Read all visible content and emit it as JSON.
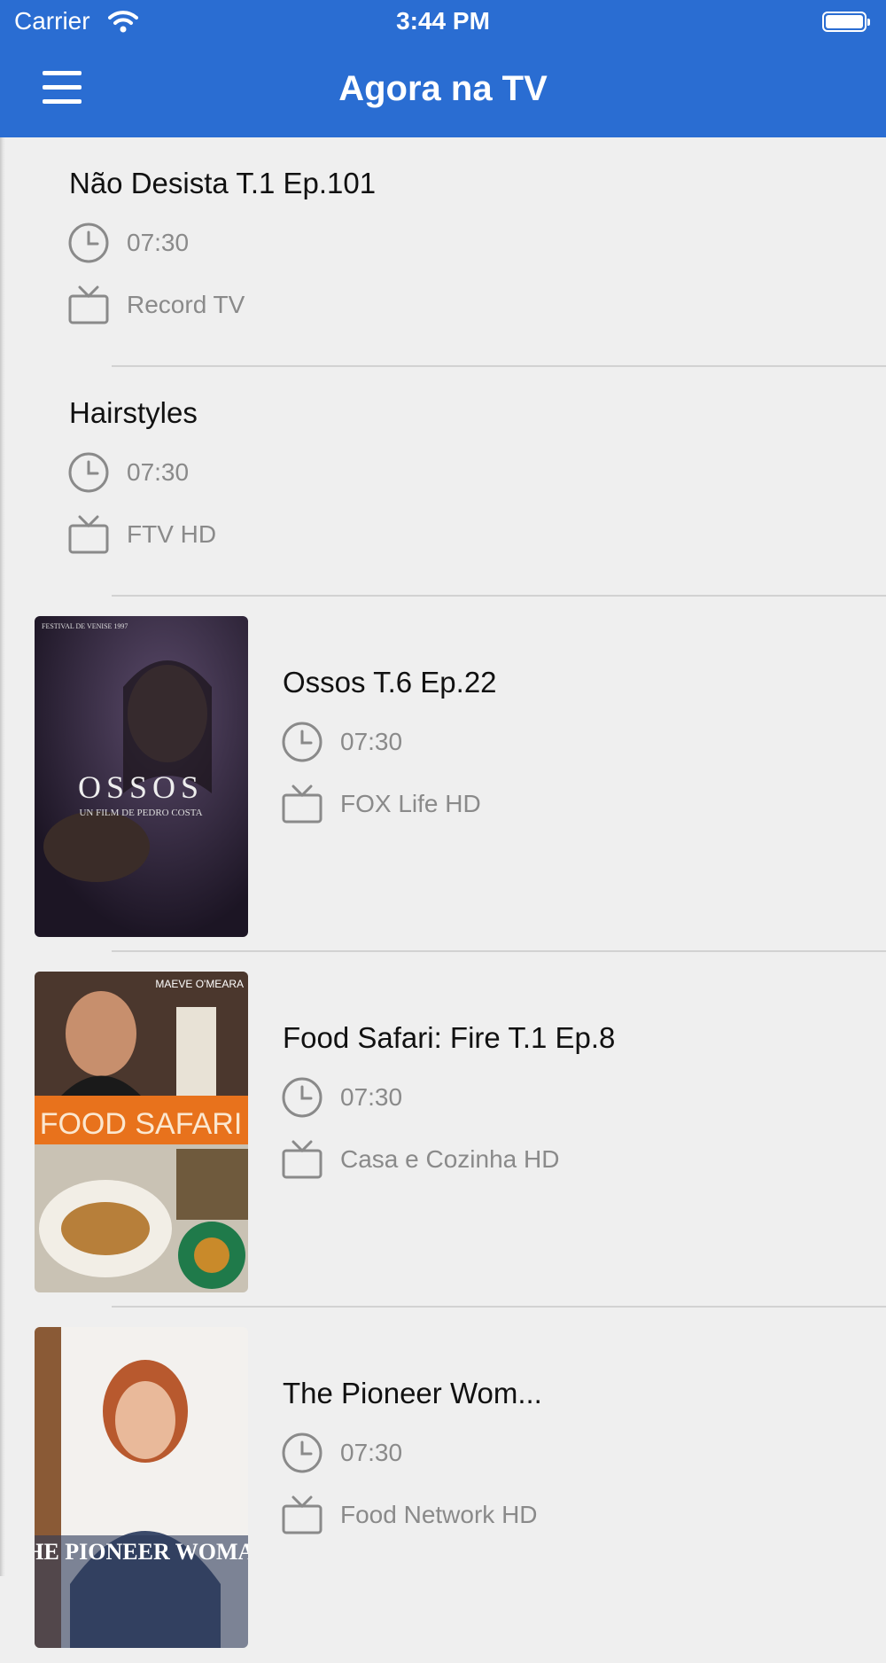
{
  "status_bar": {
    "carrier": "Carrier",
    "time": "3:44 PM"
  },
  "header": {
    "title": "Agora na TV",
    "menu_icon": "hamburger-menu-icon",
    "color": "#2a6dd2"
  },
  "icons": {
    "time": "clock-icon",
    "channel": "tv-icon"
  },
  "programs": [
    {
      "name": "Não Desista T.1 Ep.101",
      "time": "07:30",
      "channel": "Record TV"
    },
    {
      "name": "Hairstyles",
      "time": "07:30",
      "channel": "FTV HD"
    },
    {
      "name": "Ossos T.6 Ep.22",
      "time": "07:30",
      "channel": "FOX Life HD",
      "poster": {
        "top_text": "FESTIVAL DE VENISE 1997",
        "title": "OSSOS",
        "subtitle": "UN FILM DE PEDRO COSTA"
      }
    },
    {
      "name": "Food Safari: Fire T.1 Ep.8",
      "time": "07:30",
      "channel": "Casa e Cozinha HD",
      "poster": {
        "top_text": "MAEVE O'MEARA",
        "title": "FOOD SAFARI"
      }
    },
    {
      "name": "The Pioneer Wom...",
      "time": "07:30",
      "channel": "Food Network HD",
      "poster": {
        "title": "THE PIONEER WOMAN"
      }
    }
  ]
}
